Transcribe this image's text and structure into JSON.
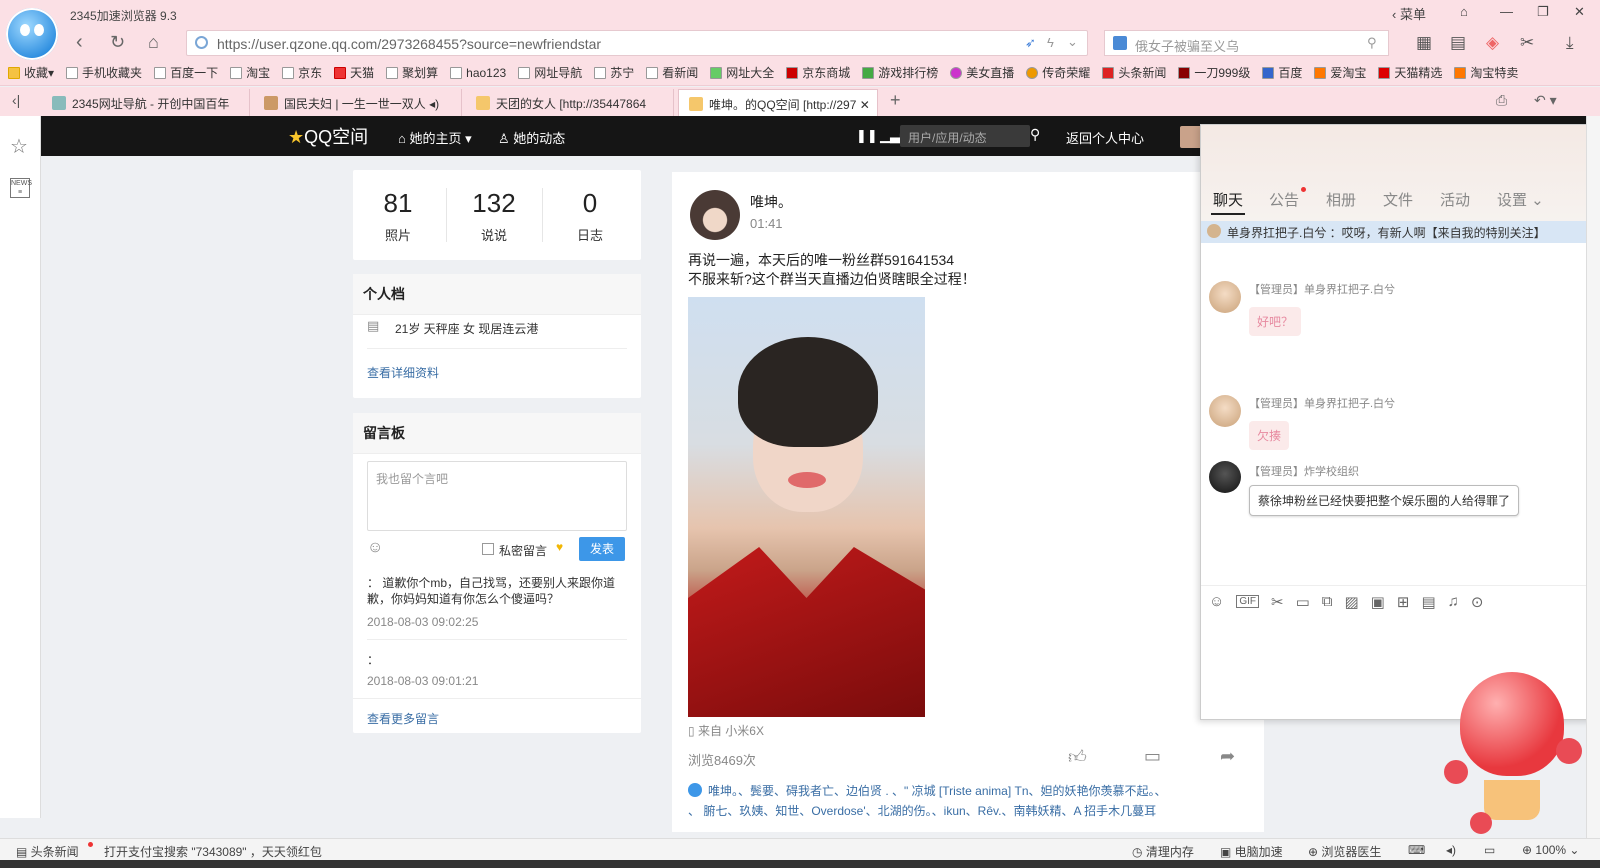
{
  "browser": {
    "title": "2345加速浏览器 9.3",
    "url": "https://user.qzone.qq.com/2973268455?source=newfriendstar",
    "search_placeholder": "俄女子被骗至义乌",
    "menu_label": "菜单"
  },
  "bookmarks": [
    "收藏",
    "手机收藏夹",
    "百度一下",
    "淘宝",
    "京东",
    "天猫",
    "聚划算",
    "hao123",
    "网址导航",
    "苏宁",
    "看新闻",
    "网址大全",
    "京东商城",
    "游戏排行榜",
    "美女直播",
    "传奇荣耀",
    "头条新闻",
    "一刀999级",
    "百度",
    "爱淘宝",
    "天猫精选",
    "淘宝特卖"
  ],
  "tabs": [
    {
      "label": "2345网址导航 - 开创中国百年"
    },
    {
      "label": "国民夫妇 | 一生一世一双人"
    },
    {
      "label": "天团的女人 [http://35447864"
    },
    {
      "label": "唯坤。的QQ空间 [http://297"
    }
  ],
  "qzone": {
    "logo": "QQ空间",
    "nav_home": "她的主页",
    "nav_feed": "她的动态",
    "search_placeholder": "用户/应用/动态",
    "back_center": "返回个人中心"
  },
  "stats": [
    {
      "num": "81",
      "label": "照片"
    },
    {
      "num": "132",
      "label": "说说"
    },
    {
      "num": "0",
      "label": "日志"
    }
  ],
  "profile": {
    "title": "个人档",
    "info": "21岁  天秤座 女 现居连云港",
    "more": "查看详细资料"
  },
  "guestbook": {
    "title": "留言板",
    "placeholder": "我也留个言吧",
    "private_label": "私密留言",
    "post_label": "发表",
    "entries": [
      {
        "text": "：  道歉你个mb，自己找骂，还要别人来跟你道歉，你妈妈知道有你怎么个傻逼吗？",
        "time": "2018-08-03 09:02:25"
      },
      {
        "text": "：",
        "time": "2018-08-03 09:01:21"
      }
    ],
    "more": "查看更多留言"
  },
  "post": {
    "author": "唯坤。",
    "time": "01:41",
    "line1": "再说一遍，本天后的唯一粉丝群591641534",
    "line2": "不服来斩?这个群当天直播边伯贤瞎眼全过程！",
    "from": "来自 小米6X",
    "views": "浏览8469次",
    "likes_line1": "唯坤。、鬓要、碍我者亡、边伯贤 . 、\" 凉城 [Triste anima] Tn、妲的妖艳你羡慕不起。、",
    "likes_line2": "、 腑七、玖姨、知世、Overdose'、北湖的伤。、ikun、Rêv.、南韩妖精、A 招手木几蔓耳"
  },
  "chat": {
    "tabs": [
      "聊天",
      "公告",
      "相册",
      "文件",
      "活动",
      "设置"
    ],
    "notice": "单身界扛把子.白兮 ：哎呀，有新人啊【来自我的特别关注】",
    "messages": [
      {
        "name": "【管理员】单身界扛把子.白兮",
        "text": "好吧？"
      },
      {
        "name": "【管理员】单身界扛把子.白兮",
        "text": "欠揍"
      },
      {
        "name": "【管理员】炸学校组织",
        "text": "蔡徐坤粉丝已经快要把整个娱乐圈的人给得罪了"
      }
    ]
  },
  "statusbar": {
    "news": "头条新闻",
    "tip": "打开支付宝搜索 \"7343089\" ，天天领红包",
    "clean": "清理内存",
    "speed": "电脑加速",
    "doctor": "浏览器医生",
    "zoom": "100%"
  }
}
